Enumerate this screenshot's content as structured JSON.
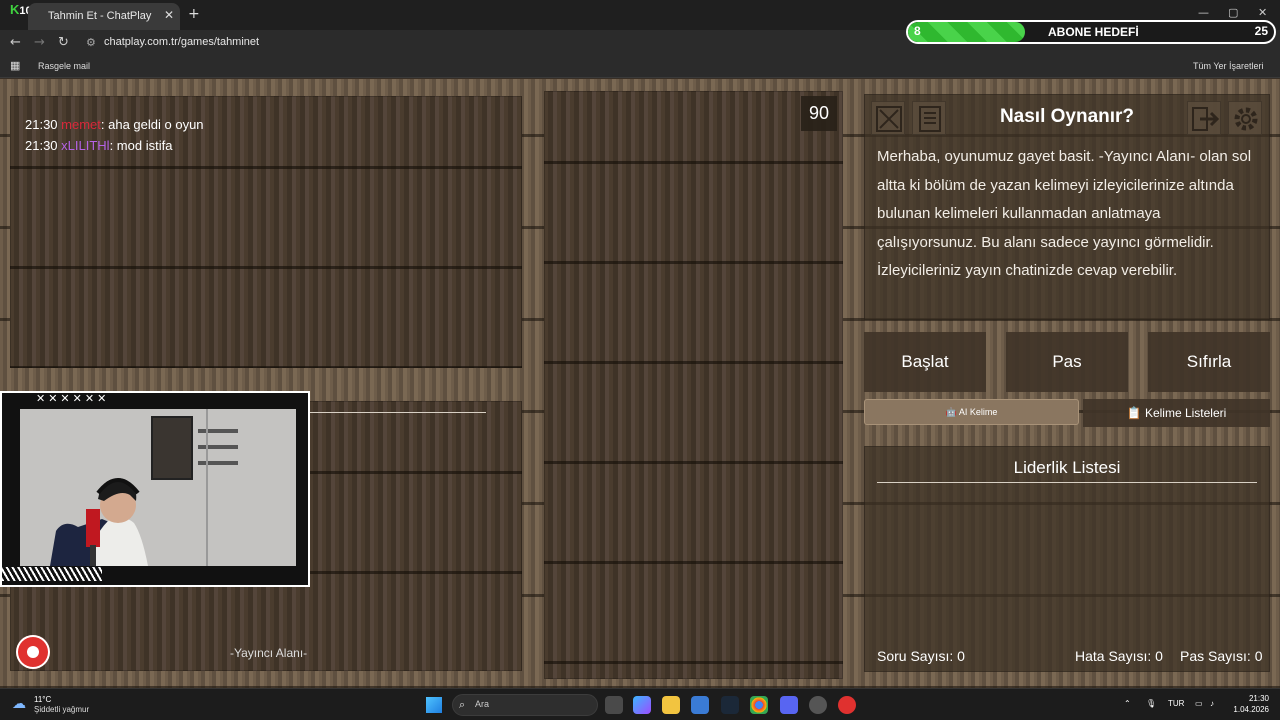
{
  "browser": {
    "tab_title": "Tahmin Et - ChatPlay",
    "url": "chatplay.com.tr/games/tahminet",
    "bookmark_left": "Rasgele mail",
    "bookmark_right": "Tüm Yer İşaretleri",
    "tab_close": "✕",
    "new_tab": "+",
    "min": "—",
    "max": "▢",
    "close": "✕",
    "back": "←",
    "forward": "→",
    "reload": "↻"
  },
  "overlay": {
    "logo_letter": "K",
    "logo_number": "10",
    "subgoal_current": "8",
    "subgoal_title": "ABONE HEDEFİ",
    "subgoal_target": "25",
    "subgoal_progress": 0.32
  },
  "chat": {
    "messages": [
      {
        "time": "21:30",
        "user": "memet",
        "text": ": aha geldi o oyun"
      },
      {
        "time": "21:30",
        "user": "xLILITHl",
        "text": ": mod istifa"
      }
    ]
  },
  "game": {
    "timer": "90",
    "help_title": "Nasıl Oynanır?",
    "help_text": "Merhaba, oyunumuz gayet basit. -Yayıncı Alanı- olan sol altta ki bölüm de yazan kelimeyi izleyicilerinize altında bulunan kelimeleri kullanmadan anlatmaya çalışıyorsunuz. Bu alanı sadece yayıncı görmelidir. İzleyicileriniz yayın chatinizde cevap verebilir.",
    "buttons": {
      "start": "Başlat",
      "pass": "Pas",
      "reset": "Sıfırla"
    },
    "ai_word": "🤖 AI Kelime",
    "word_lists": "📋 Kelime Listeleri",
    "leaderboard_title": "Liderlik Listesi",
    "stats": {
      "questions": "Soru Sayısı: 0",
      "errors": "Hata Sayısı: 0",
      "passes": "Pas Sayısı: 0"
    },
    "streamer_area": "-Yayıncı Alanı-"
  },
  "webcam": {
    "marks": "✕✕✕✕✕✕"
  },
  "taskbar": {
    "temperature": "11°C",
    "weather": "Şiddetli yağmur",
    "search_placeholder": "Ara",
    "lang": "TUR",
    "time": "21:30",
    "date": "1.04.2026"
  }
}
